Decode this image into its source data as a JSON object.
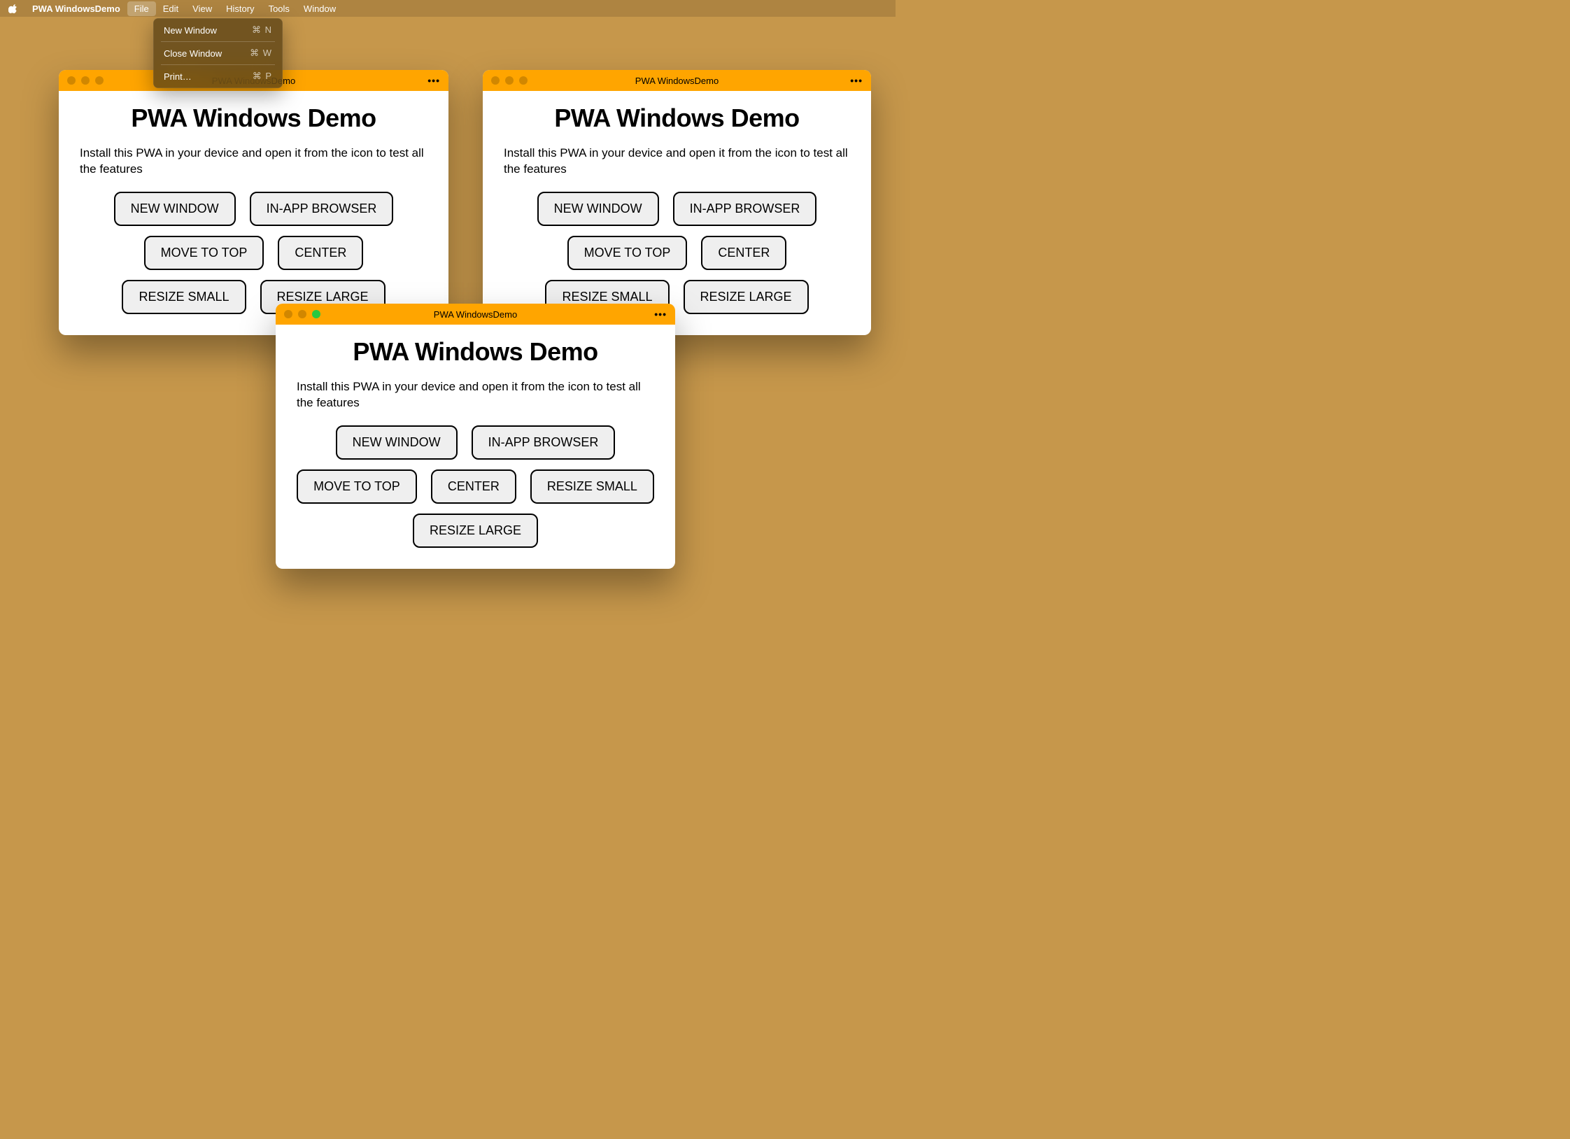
{
  "menubar": {
    "app_name": "PWA WindowsDemo",
    "items": [
      "File",
      "Edit",
      "View",
      "History",
      "Tools",
      "Window"
    ],
    "active_index": 0
  },
  "dropdown": {
    "items": [
      {
        "label": "New Window",
        "shortcut": "⌘ N"
      },
      {
        "label": "Close Window",
        "shortcut": "⌘ W"
      },
      {
        "label": "Print…",
        "shortcut": "⌘ P"
      }
    ]
  },
  "window": {
    "title": "PWA WindowsDemo",
    "heading": "PWA Windows Demo",
    "description": "Install this PWA in your device and open it from the icon to test all the features",
    "buttons": [
      "NEW WINDOW",
      "IN-APP BROWSER",
      "MOVE TO TOP",
      "CENTER",
      "RESIZE SMALL",
      "RESIZE LARGE"
    ],
    "menu_dots": "•••"
  }
}
